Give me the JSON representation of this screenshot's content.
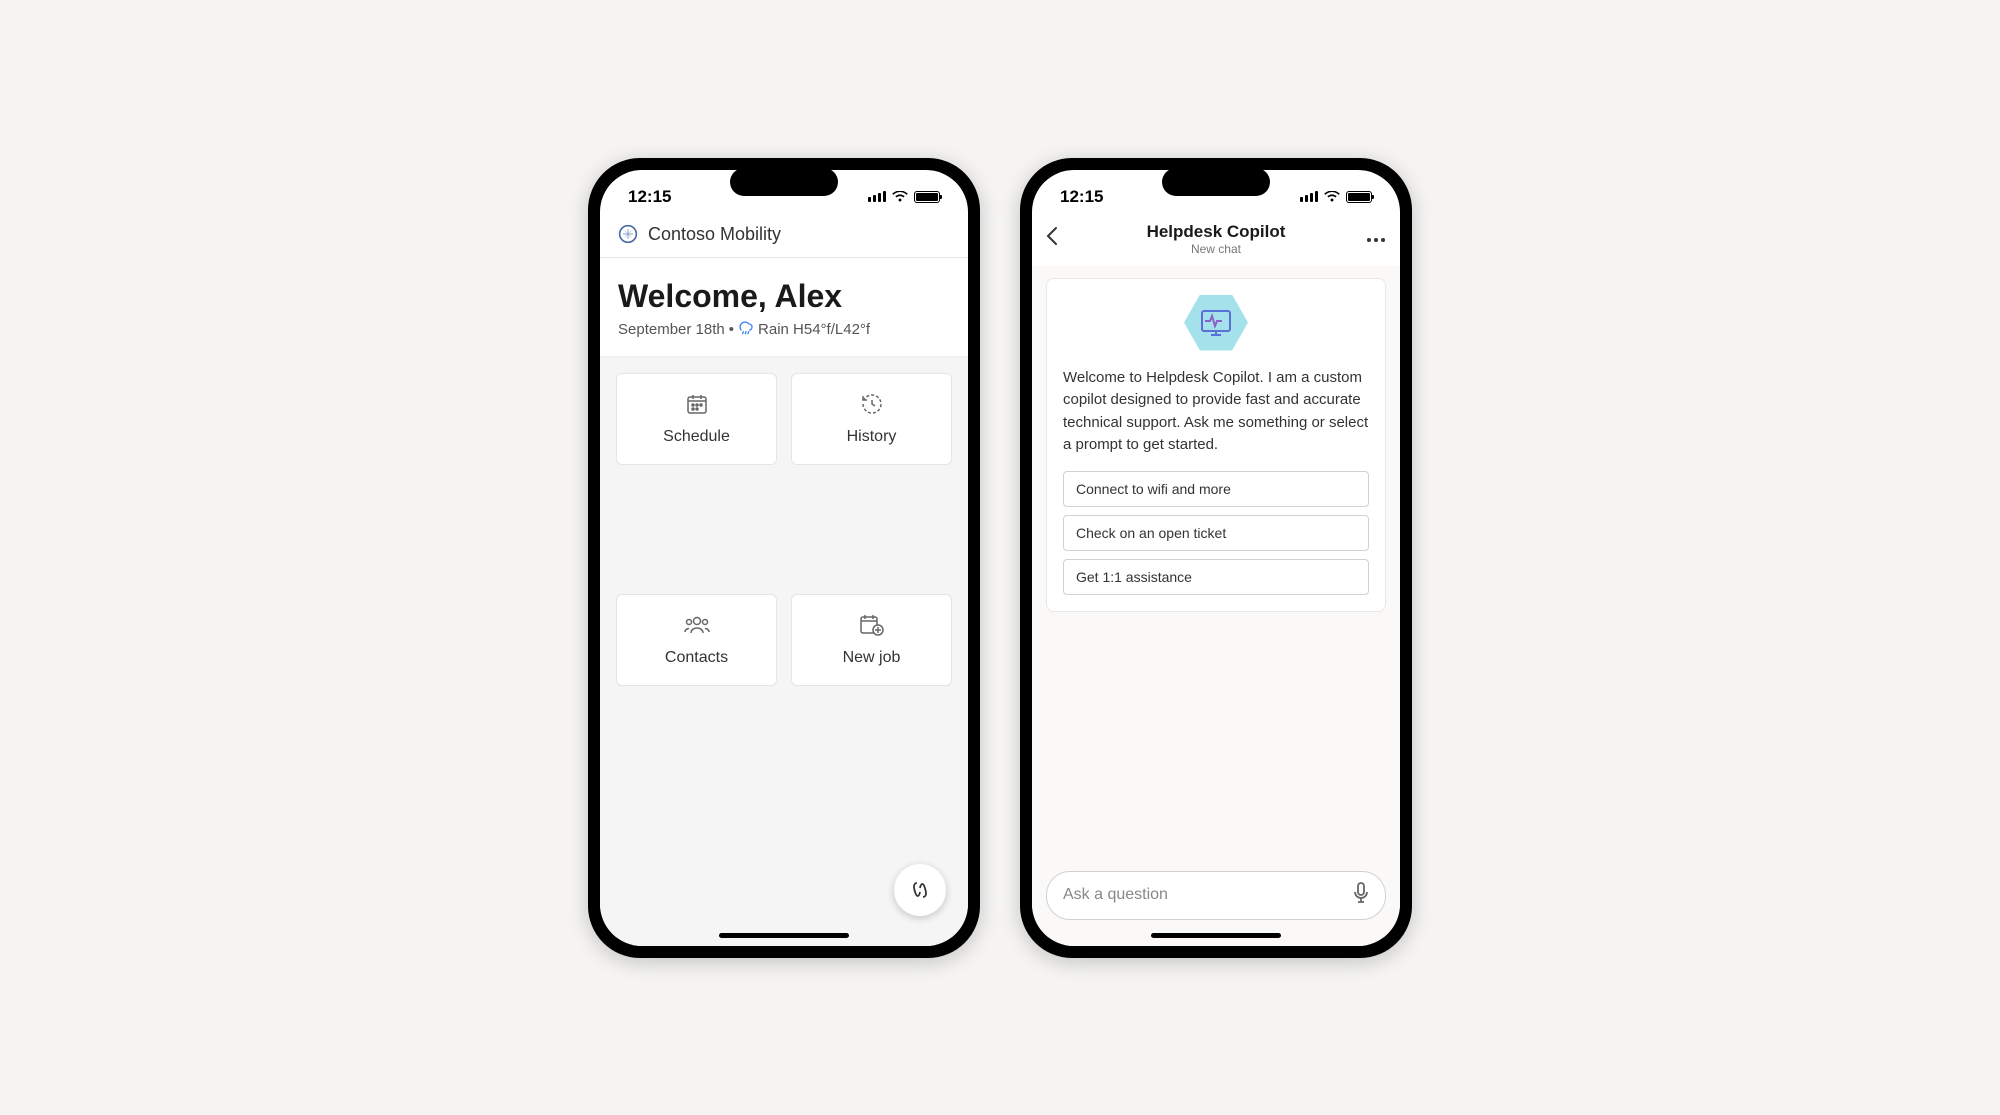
{
  "phone1": {
    "status": {
      "time": "12:15"
    },
    "app": {
      "name": "Contoso Mobility"
    },
    "welcome": {
      "title": "Welcome, Alex",
      "date": "September 18th",
      "weather_label": "Rain H54°f/L42°f"
    },
    "tiles": [
      {
        "label": "Schedule",
        "icon": "calendar"
      },
      {
        "label": "History",
        "icon": "history"
      },
      {
        "label": "Contacts",
        "icon": "contacts"
      },
      {
        "label": "New job",
        "icon": "new-job"
      }
    ]
  },
  "phone2": {
    "status": {
      "time": "12:15"
    },
    "header": {
      "title": "Helpdesk Copilot",
      "subtitle": "New chat"
    },
    "intro": "Welcome to Helpdesk Copilot. I am a custom copilot designed to provide fast and accurate technical support. Ask me something or select a prompt to get started.",
    "prompts": [
      "Connect to wifi and more",
      "Check on an open ticket",
      "Get 1:1 assistance"
    ],
    "input": {
      "placeholder": "Ask a question"
    }
  }
}
